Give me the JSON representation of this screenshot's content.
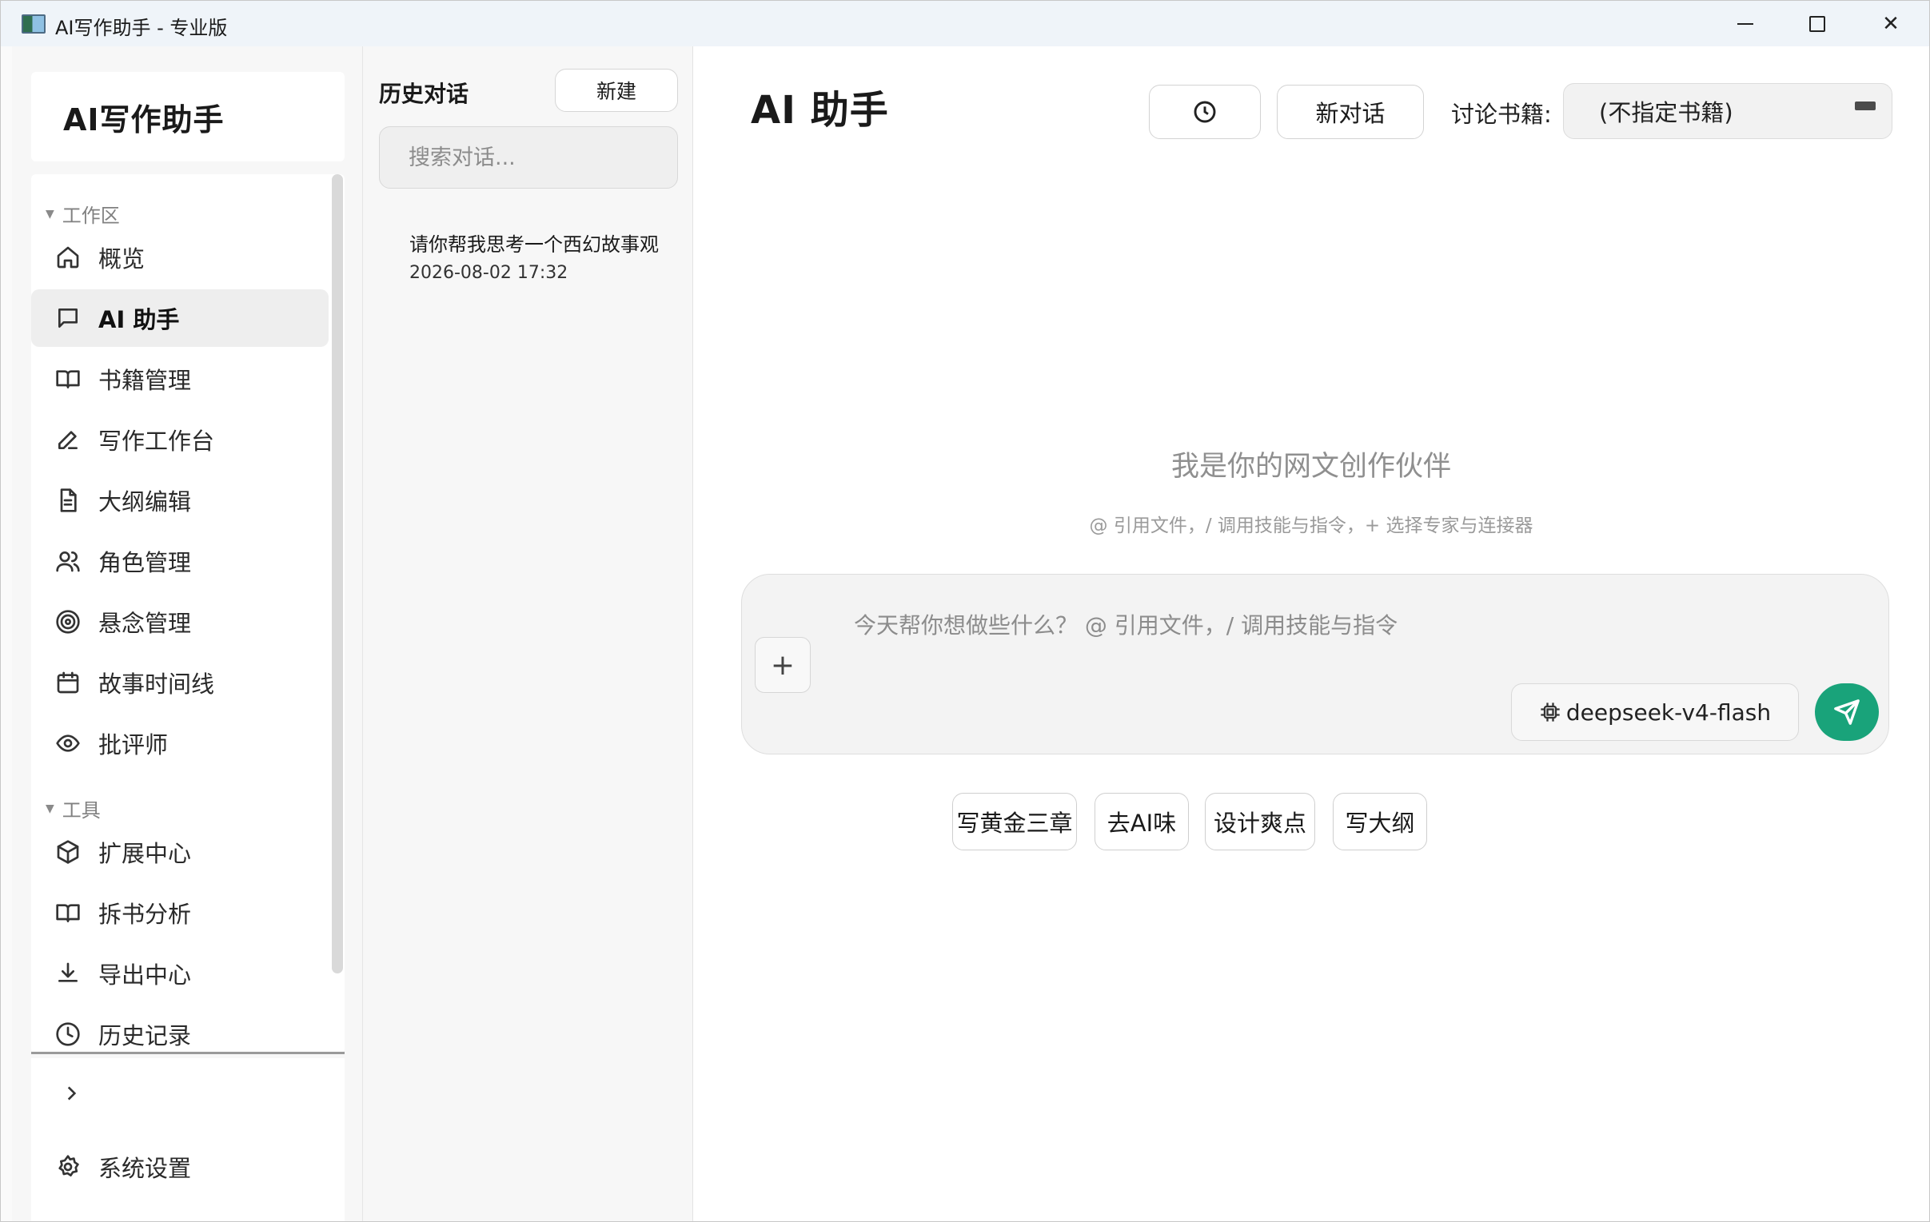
{
  "window": {
    "title": "AI写作助手 - 专业版",
    "controls": {
      "minimize": "minimize-icon",
      "maximize": "maximize-icon",
      "close": "✕"
    }
  },
  "sidebar": {
    "brand": "AI写作助手",
    "sections": [
      {
        "label": "工作区",
        "items": [
          {
            "label": "概览",
            "icon": "home-icon"
          },
          {
            "label": "AI 助手",
            "icon": "chat-icon",
            "active": true
          },
          {
            "label": "书籍管理",
            "icon": "book-open-icon"
          },
          {
            "label": "写作工作台",
            "icon": "pen-icon"
          },
          {
            "label": "大纲编辑",
            "icon": "document-icon"
          },
          {
            "label": "角色管理",
            "icon": "users-icon"
          },
          {
            "label": "悬念管理",
            "icon": "target-icon"
          },
          {
            "label": "故事时间线",
            "icon": "calendar-icon"
          },
          {
            "label": "批评师",
            "icon": "eye-icon"
          }
        ]
      },
      {
        "label": "工具",
        "items": [
          {
            "label": "扩展中心",
            "icon": "package-icon"
          },
          {
            "label": "拆书分析",
            "icon": "book-open-icon"
          },
          {
            "label": "导出中心",
            "icon": "download-icon"
          },
          {
            "label": "历史记录",
            "icon": "clock-icon"
          }
        ]
      }
    ],
    "settings_label": "系统设置"
  },
  "history": {
    "title": "历史对话",
    "new_button": "新建",
    "search_placeholder": "搜索对话...",
    "items": [
      {
        "title": "请你帮我思考一个西幻故事观",
        "time": "2026-08-02 17:32"
      }
    ]
  },
  "main": {
    "title": "AI 助手",
    "new_chat_button": "新对话",
    "book_label": "讨论书籍:",
    "book_selected": "(不指定书籍)",
    "hero_title": "我是你的网文创作伙伴",
    "hero_subtitle": "@ 引用文件，/ 调用技能与指令，+ 选择专家与连接器",
    "input_placeholder": "今天帮你想做些什么？ @ 引用文件，/ 调用技能与指令",
    "model": "deepseek-v4-flash",
    "send_color": "#19a37a",
    "quick_actions": [
      "写黄金三章",
      "去AI味",
      "设计爽点",
      "写大纲"
    ]
  }
}
